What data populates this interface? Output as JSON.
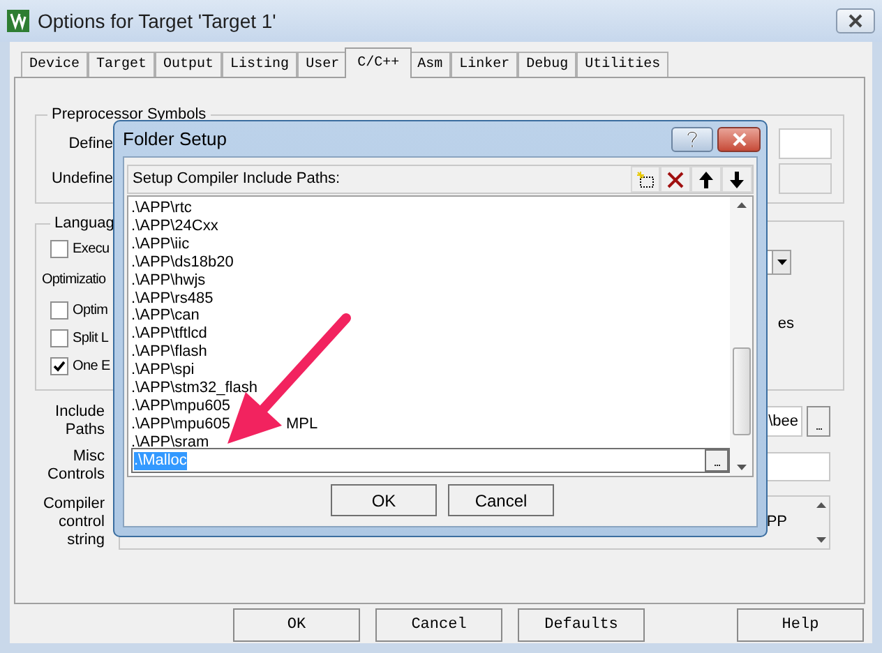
{
  "window": {
    "title": "Options for Target 'Target 1'"
  },
  "tabs": [
    {
      "label": "Device",
      "selected": false
    },
    {
      "label": "Target",
      "selected": false
    },
    {
      "label": "Output",
      "selected": false
    },
    {
      "label": "Listing",
      "selected": false
    },
    {
      "label": "User",
      "selected": false
    },
    {
      "label": "C/C++",
      "selected": true
    },
    {
      "label": "Asm",
      "selected": false
    },
    {
      "label": "Linker",
      "selected": false
    },
    {
      "label": "Debug",
      "selected": false
    },
    {
      "label": "Utilities",
      "selected": false
    }
  ],
  "preprocessor": {
    "title": "Preprocessor Symbols",
    "define_label": "Define",
    "undefine_label": "Undefine"
  },
  "language": {
    "title": "Languag",
    "items": [
      {
        "kind": "checkbox",
        "label": "Execu",
        "checked": false
      },
      {
        "kind": "text",
        "label": "Optimizatio"
      },
      {
        "kind": "checkbox",
        "label": "Optim",
        "checked": false
      },
      {
        "kind": "checkbox",
        "label": "Split L",
        "checked": false
      },
      {
        "kind": "checkbox",
        "label": "One E",
        "checked": true
      }
    ],
    "right_text": "es"
  },
  "include_paths": {
    "label": "Include Paths",
    "value": "\\bee",
    "button": "..."
  },
  "misc_controls": {
    "label": "Misc Controls"
  },
  "compiler_control": {
    "label": "Compiler control string",
    "value": "PP"
  },
  "buttons": [
    "OK",
    "Cancel",
    "Defaults",
    "Help"
  ],
  "folder_setup": {
    "title": "Folder Setup",
    "heading": "Setup Compiler Include Paths:",
    "paths": [
      {
        "text": ".\\APP\\rtc"
      },
      {
        "text": ".\\APP\\24Cxx"
      },
      {
        "text": ".\\APP\\iic"
      },
      {
        "text": ".\\APP\\ds18b20"
      },
      {
        "text": ".\\APP\\hwjs"
      },
      {
        "text": ".\\APP\\rs485"
      },
      {
        "text": ".\\APP\\can"
      },
      {
        "text": ".\\APP\\tftlcd"
      },
      {
        "text": ".\\APP\\flash"
      },
      {
        "text": ".\\APP\\spi"
      },
      {
        "text": ".\\APP\\stm32_flash"
      },
      {
        "text": ".\\APP\\mpu605"
      },
      {
        "text": ".\\APP\\mpu605",
        "tail": "MPL"
      },
      {
        "text": ".\\APP\\sram"
      }
    ],
    "editing": ".\\Malloc",
    "browse_button": "...",
    "buttons": [
      "OK",
      "Cancel"
    ]
  }
}
